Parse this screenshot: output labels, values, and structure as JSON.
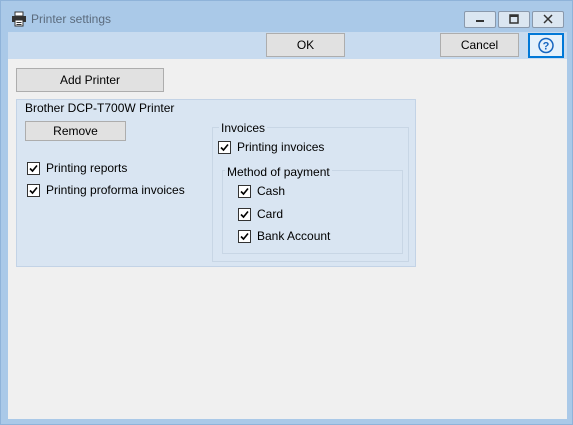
{
  "window": {
    "title": "Printer settings",
    "icon": "printer-icon",
    "controls": [
      "minimize-icon",
      "maximize-icon",
      "close-icon"
    ]
  },
  "toolbar": {
    "ok_label": "OK",
    "cancel_label": "Cancel",
    "help_icon": "question-circle-icon"
  },
  "main": {
    "add_printer_label": "Add Printer"
  },
  "printer": {
    "name": "Brother DCP-T700W Printer",
    "remove_label": "Remove",
    "options": [
      {
        "label": "Printing reports",
        "checked": true
      },
      {
        "label": "Printing proforma invoices",
        "checked": true
      }
    ],
    "invoices": {
      "legend": "Invoices",
      "printing_invoices": {
        "label": "Printing invoices",
        "checked": true
      },
      "payment": {
        "legend": "Method of payment",
        "methods": [
          {
            "label": "Cash",
            "checked": true
          },
          {
            "label": "Card",
            "checked": true
          },
          {
            "label": "Bank Account",
            "checked": true
          }
        ]
      }
    }
  },
  "colors": {
    "frame": "#aac9e8",
    "toolbar": "#c8dbef",
    "panel": "#d9e5f2",
    "client": "#f0f0f0",
    "focus": "#0078d7"
  }
}
